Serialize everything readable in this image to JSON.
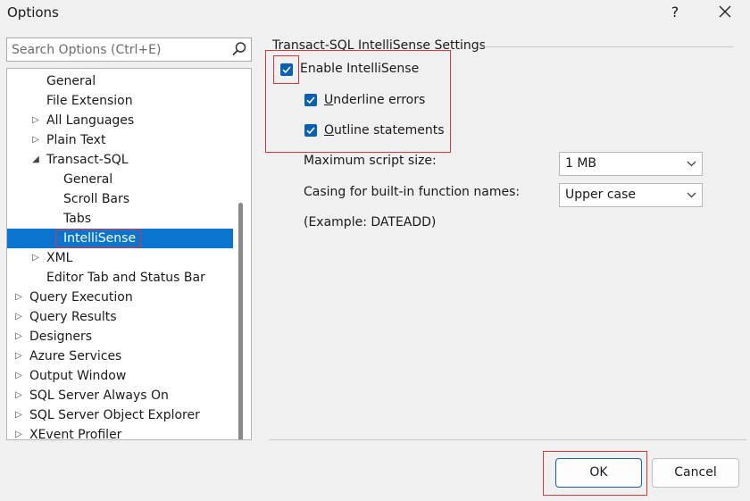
{
  "window": {
    "title": "Options",
    "help_label": "?"
  },
  "search": {
    "placeholder": "Search Options (Ctrl+E)"
  },
  "tree": {
    "items": [
      {
        "label": "General",
        "expander": ""
      },
      {
        "label": "File Extension",
        "expander": ""
      },
      {
        "label": "All Languages",
        "expander": "▷"
      },
      {
        "label": "Plain Text",
        "expander": "▷"
      },
      {
        "label": "Transact-SQL",
        "expander": "◢"
      },
      {
        "label": "General",
        "expander": ""
      },
      {
        "label": "Scroll Bars",
        "expander": ""
      },
      {
        "label": "Tabs",
        "expander": ""
      },
      {
        "label": "IntelliSense",
        "expander": "",
        "selected": true
      },
      {
        "label": "XML",
        "expander": "▷"
      },
      {
        "label": "Editor Tab and Status Bar",
        "expander": ""
      },
      {
        "label": "Query Execution",
        "expander": "▷"
      },
      {
        "label": "Query Results",
        "expander": "▷"
      },
      {
        "label": "Designers",
        "expander": "▷"
      },
      {
        "label": "Azure Services",
        "expander": "▷"
      },
      {
        "label": "Output Window",
        "expander": "▷"
      },
      {
        "label": "SQL Server Always On",
        "expander": "▷"
      },
      {
        "label": "SQL Server Object Explorer",
        "expander": "▷"
      },
      {
        "label": "XEvent Profiler",
        "expander": "▷"
      }
    ]
  },
  "settings": {
    "group_title": "Transact-SQL IntelliSense Settings",
    "enable_intellisense": {
      "label": "Enable IntelliSense",
      "checked": true
    },
    "underline_errors": {
      "mnemonic": "U",
      "rest": "nderline errors",
      "checked": true
    },
    "outline_statements": {
      "mnemonic": "O",
      "rest": "utline statements",
      "checked": true
    },
    "max_script_size": {
      "label": "Maximum script size:",
      "value": "1  MB"
    },
    "casing": {
      "label": "Casing for built-in function names:",
      "value": "Upper case"
    },
    "example": "(Example: DATEADD)"
  },
  "buttons": {
    "ok": "OK",
    "cancel": "Cancel"
  },
  "colors": {
    "selection": "#0a74cf",
    "checkbox": "#0a5fb4",
    "highlight": "#d9363e"
  }
}
